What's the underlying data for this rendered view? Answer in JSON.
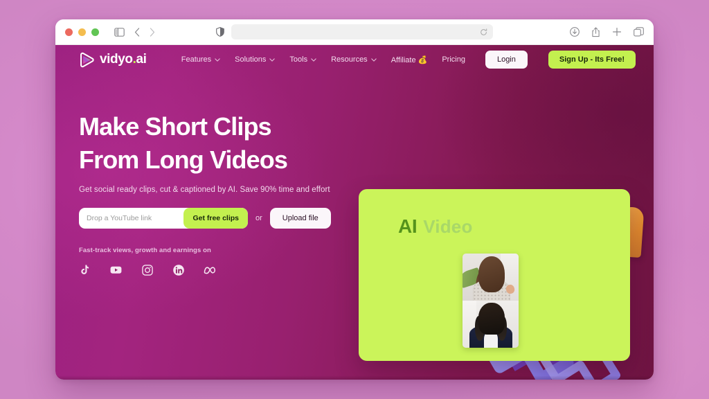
{
  "browser": {
    "traffic_lights": [
      "close",
      "minimize",
      "zoom"
    ],
    "sidebar_icon": "sidebar-icon",
    "back_icon": "chevron-left-icon",
    "forward_icon": "chevron-right-icon",
    "shield_icon": "privacy-shield-icon",
    "url_value": "",
    "url_placeholder": "",
    "reload_icon": "reload-icon",
    "downloads_icon": "download-icon",
    "share_icon": "share-icon",
    "newtab_icon": "plus-icon",
    "tabs_icon": "tab-overview-icon"
  },
  "site": {
    "nav": {
      "logo_text": "vidyo",
      "logo_dot": ".",
      "logo_suffix": "ai",
      "logo_icon": "play-logo-icon",
      "links": [
        {
          "label": "Features",
          "has_caret": true
        },
        {
          "label": "Solutions",
          "has_caret": true
        },
        {
          "label": "Tools",
          "has_caret": true
        },
        {
          "label": "Resources",
          "has_caret": true
        },
        {
          "label": "Affiliate 💰",
          "has_caret": false
        },
        {
          "label": "Pricing",
          "has_caret": false
        }
      ],
      "login_label": "Login",
      "signup_label": "Sign Up - Its Free!"
    },
    "hero": {
      "headline_line1": "Make Short Clips",
      "headline_line2": "From Long Videos",
      "subheadline": "Get social ready clips, cut & captioned by AI. Save 90% time and effort",
      "input_placeholder": "Drop a YouTube link",
      "input_value": "",
      "get_clips_label": "Get free clips",
      "or_label": "or",
      "upload_label": "Upload file",
      "proof_text": "Fast-track views, growth and earnings on",
      "socials": [
        {
          "name": "tiktok-icon"
        },
        {
          "name": "youtube-icon"
        },
        {
          "name": "instagram-icon"
        },
        {
          "name": "linkedin-icon"
        },
        {
          "name": "meta-icon"
        }
      ]
    },
    "visual": {
      "card_title_strong": "AI",
      "card_title_light": "Video",
      "card_bg_color": "#cbf45a",
      "clip_panes": [
        "speaker-top",
        "speaker-bottom"
      ]
    },
    "colors": {
      "brand_green": "#c3f04f",
      "brand_magenta": "#9c2180",
      "brand_wine": "#6f1442",
      "page_backdrop": "#dd93d3"
    }
  }
}
